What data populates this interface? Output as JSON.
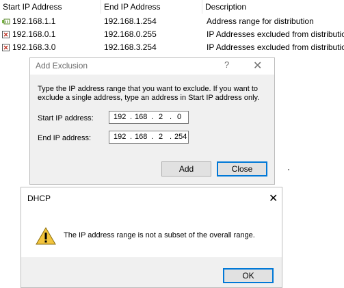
{
  "list": {
    "headers": [
      "Start IP Address",
      "End IP Address",
      "Description"
    ],
    "rows": [
      {
        "icon": "address-range-icon",
        "start": "192.168.1.1",
        "end": "192.168.1.254",
        "desc": "Address range for distribution"
      },
      {
        "icon": "exclusion-icon",
        "start": "192.168.0.1",
        "end": "192.168.0.255",
        "desc": "IP Addresses excluded from distribution"
      },
      {
        "icon": "exclusion-icon",
        "start": "192.168.3.0",
        "end": "192.168.3.254",
        "desc": "IP Addresses excluded from distribution"
      }
    ]
  },
  "add_exclusion": {
    "title": "Add Exclusion",
    "help": "?",
    "close": "✕",
    "instructions": "Type the IP address range that you want to exclude. If you want to exclude a single address, type an address in Start IP address only.",
    "start_label": "Start IP address:",
    "end_label": "End IP address:",
    "start_ip": [
      "192",
      "168",
      "2",
      "0"
    ],
    "end_ip": [
      "192",
      "168",
      "2",
      "254"
    ],
    "add_label": "Add",
    "close_label": "Close"
  },
  "dhcp": {
    "title": "DHCP",
    "close": "✕",
    "message": "The IP address range is not a subset of the overall range.",
    "ok_label": "OK"
  },
  "colors": {
    "accent": "#0078d7",
    "dialog_bg": "#f0f0f0",
    "warning": "#f2c43d"
  }
}
